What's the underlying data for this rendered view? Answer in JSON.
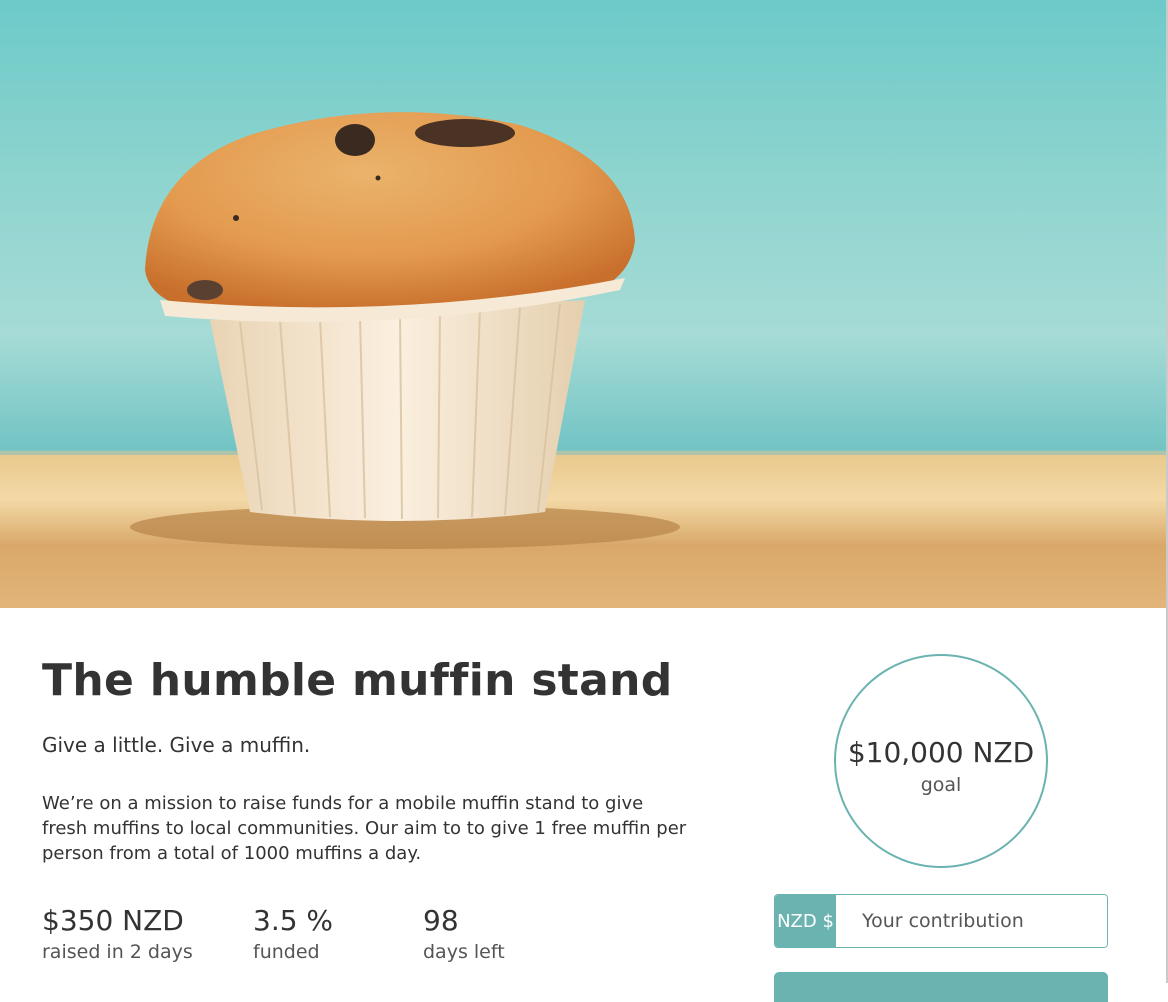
{
  "project": {
    "title": "The humble muffin stand",
    "tagline": "Give a little. Give a muffin.",
    "description": "We’re on a mission to raise funds for a mobile muffin stand to give fresh muffins to local communities. Our aim to to give 1 free muffin per person from a total of 1000 muffins a day."
  },
  "stats": [
    {
      "value": "$350 NZD",
      "label": "raised in 2 days"
    },
    {
      "value": "3.5 %",
      "label": "funded"
    },
    {
      "value": "98",
      "label": "days left"
    }
  ],
  "goal": {
    "amount": "$10,000 NZD",
    "label": "goal"
  },
  "contribution": {
    "currency": "NZD $",
    "placeholder": "Your contribution"
  },
  "colors": {
    "accent": "#6bb3b1",
    "text": "#333333"
  },
  "icons": {
    "hero": "muffin-photo"
  }
}
